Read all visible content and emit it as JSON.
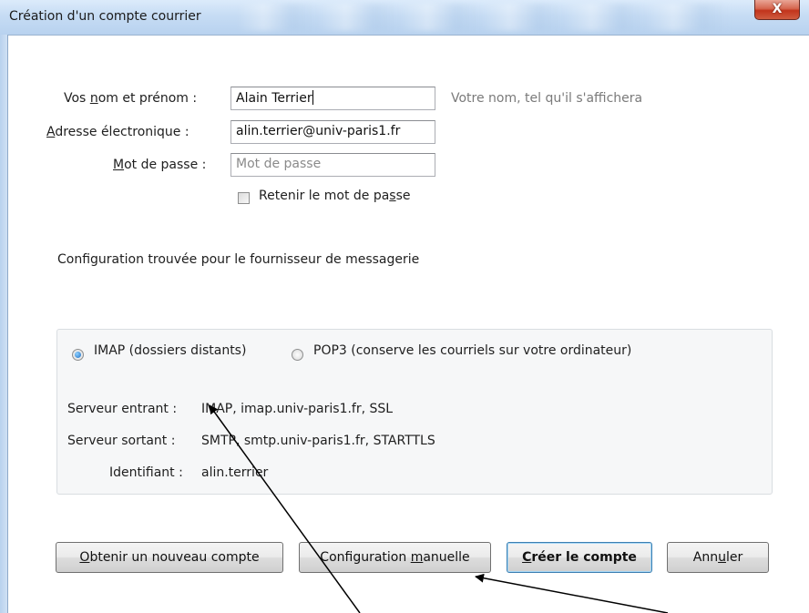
{
  "window": {
    "title": "Création d'un compte courrier",
    "close_glyph": "X"
  },
  "form": {
    "name_label": "Vos nom et prénom :",
    "name_value": "Alain Terrier",
    "name_hint": "Votre nom, tel qu'il s'affichera",
    "email_label": "Adresse électronique :",
    "email_value": "alin.terrier@univ-paris1.fr",
    "password_label": "Mot de passe :",
    "password_placeholder": "Mot de passe",
    "remember_label": "Retenir le mot de passe",
    "remember_checked": false
  },
  "config_found": "Configuration trouvée pour le fournisseur de messagerie",
  "protocol": {
    "imap_label": "IMAP (dossiers distants)",
    "pop3_label": "POP3 (conserve les courriels sur votre ordinateur)",
    "selected": "IMAP"
  },
  "servers": {
    "incoming_label": "Serveur entrant :",
    "incoming_value": "IMAP, imap.univ-paris1.fr, SSL",
    "outgoing_label": "Serveur sortant :",
    "outgoing_value": "SMTP, smtp.univ-paris1.fr, STARTTLS",
    "identifier_label": "Identifiant :",
    "identifier_value": "alin.terrier"
  },
  "buttons": {
    "new_account": "Obtenir un nouveau compte",
    "manual_config": "Configuration manuelle",
    "create": "Créer le compte",
    "cancel": "Annuler"
  },
  "annotation_color": "#000000"
}
